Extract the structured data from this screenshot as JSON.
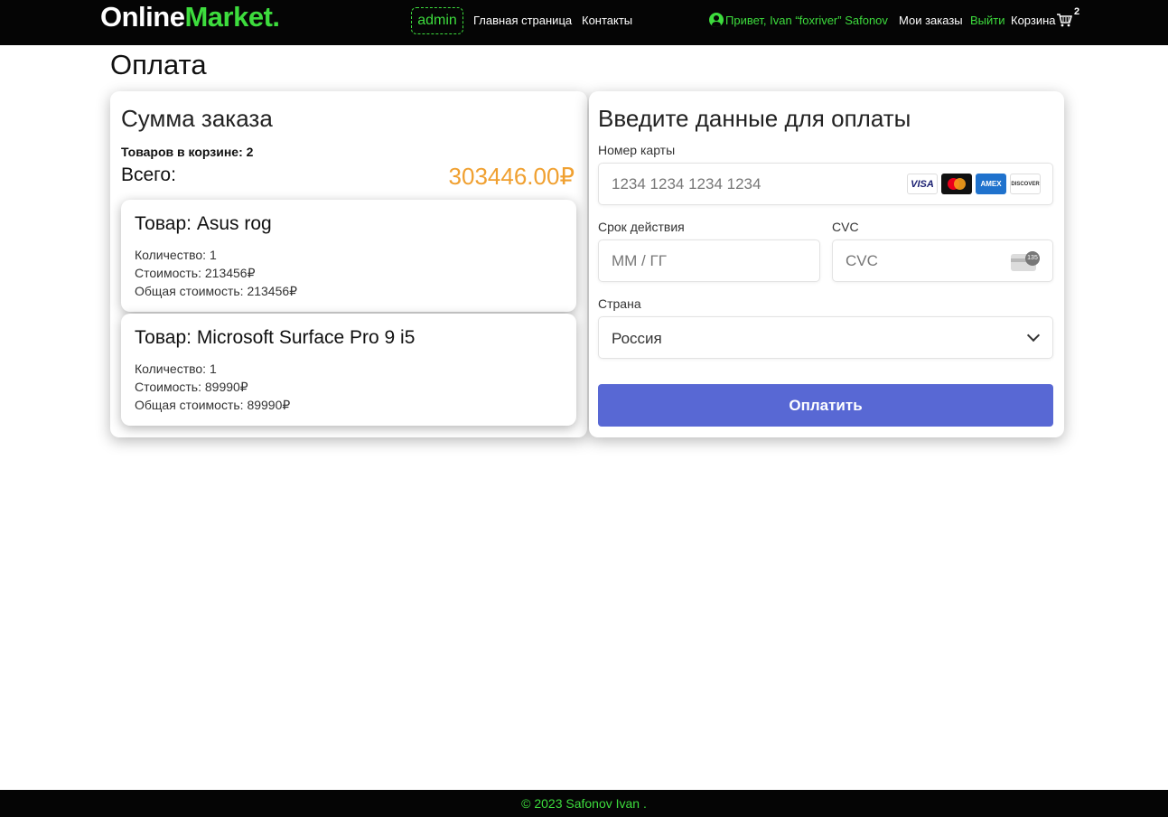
{
  "header": {
    "logo_main": "Online",
    "logo_accent": "Market.",
    "admin_label": "admin",
    "nav": [
      "Главная страница",
      "Контакты"
    ],
    "greeting": "Привет, Ivan “foxriver” Safonov",
    "my_orders": "Мои заказы",
    "logout": "Выйти",
    "cart_label": "Корзина",
    "cart_count": "2",
    "accent_color": "#3ddc3d"
  },
  "page_title": "Оплата",
  "summary": {
    "heading": "Сумма заказа",
    "cart_count_line": "Товаров в корзине: 2",
    "total_label": "Всего:",
    "total_value": "303446.00₽",
    "items": [
      {
        "title": "Товар: Asus rog",
        "qty": "Количество: 1",
        "price": "Стоимость: 213456₽",
        "total": "Общая стоимость: 213456₽"
      },
      {
        "title": "Товар: Microsoft Surface Pro 9 i5",
        "qty": "Количество: 1",
        "price": "Стоимость: 89990₽",
        "total": "Общая стоимость: 89990₽"
      }
    ]
  },
  "payment": {
    "heading": "Введите данные для оплаты",
    "card_number_label": "Номер карты",
    "card_number_placeholder": "1234 1234 1234 1234",
    "expiry_label": "Срок действия",
    "expiry_placeholder": "ММ / ГГ",
    "cvc_label": "CVC",
    "cvc_placeholder": "CVC",
    "cvc_hint": "135",
    "country_label": "Страна",
    "country_value": "Россия",
    "pay_button": "Оплатить",
    "card_brands": [
      "VISA",
      "AMEX",
      "DISCOVER"
    ],
    "button_color": "#5868d4"
  },
  "footer": {
    "text": "© 2023 Safonov Ivan ."
  }
}
